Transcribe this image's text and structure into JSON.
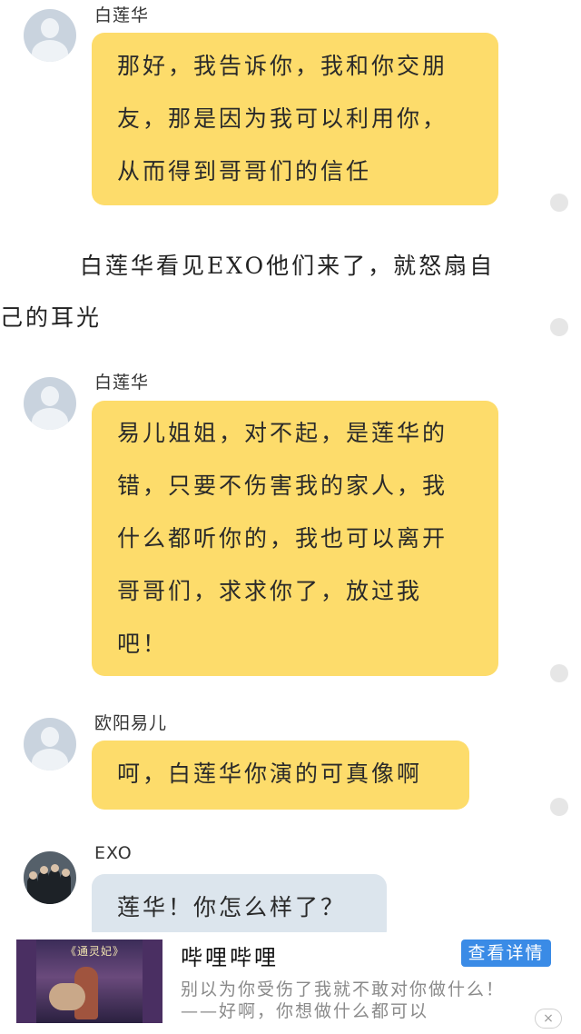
{
  "messages": [
    {
      "sender": "白莲华",
      "lines": [
        "那好，我告诉你，我和你交朋",
        "友，那是因为我可以利用你，",
        "从而得到哥哥们的信任"
      ]
    },
    {
      "sender": "白莲华",
      "lines": [
        "易儿姐姐，对不起，是莲华的",
        "错，只要不伤害我的家人，我",
        "什么都听你的，我也可以离开",
        "哥哥们，求求你了，放过我",
        "吧！"
      ]
    },
    {
      "sender": "欧阳易儿",
      "lines": [
        "呵，白莲华你演的可真像啊"
      ]
    },
    {
      "sender": "EXO",
      "lines": [
        "莲华！你怎么样了？"
      ]
    }
  ],
  "narration": {
    "lines": [
      "　白莲华看见EXO他们来了，就怒扇自",
      "己的耳光"
    ]
  },
  "ad": {
    "thumb_title": "《通灵妃》",
    "app_name": "哔哩哔哩",
    "button_label": "查看详情",
    "line1": "别以为你受伤了我就不敢对你做什么！",
    "line2": "——好啊，你想做什么都可以",
    "close_icon": "×"
  },
  "colors": {
    "bubble": "#fddc6b",
    "bubble_blue": "#dce5ed",
    "ad_button": "#3a8be6"
  }
}
